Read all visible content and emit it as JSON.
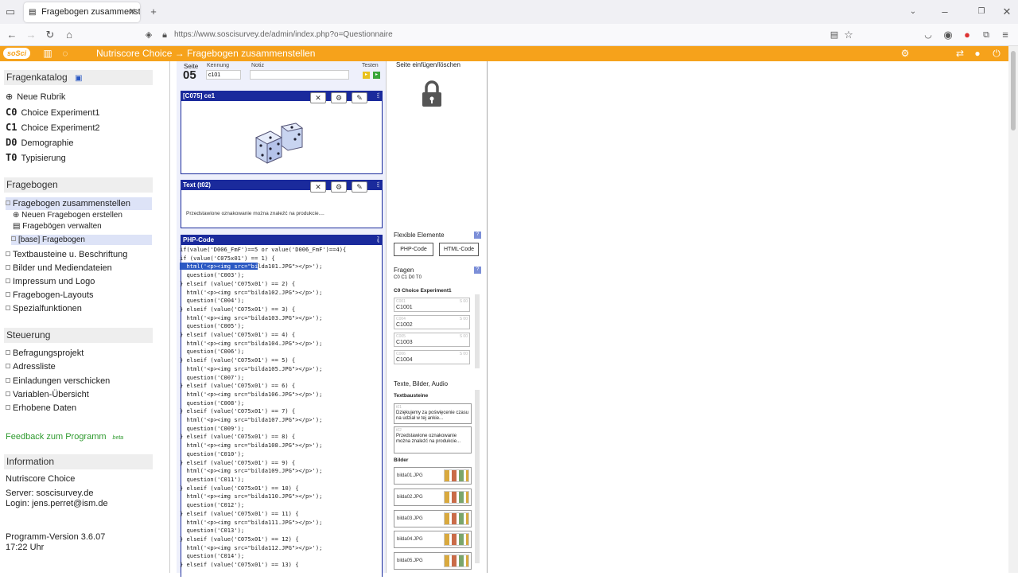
{
  "browser": {
    "tab_title": "Fragebogen zusammenstellen",
    "url": "https://www.soscisurvey.de/admin/index.php?o=Questionnaire"
  },
  "appbar": {
    "logo": "soSci",
    "title": "Nutriscore Choice → Fragebogen zusammenstellen",
    "color": "#f6a21b"
  },
  "sidebar": {
    "fragenkatalog": {
      "title": "Fragenkatalog",
      "items": [
        {
          "code": "",
          "label": "Neue Rubrik"
        },
        {
          "code": "C0",
          "label": "Choice Experiment1"
        },
        {
          "code": "C1",
          "label": "Choice Experiment2"
        },
        {
          "code": "D0",
          "label": "Demographie"
        },
        {
          "code": "T0",
          "label": "Typisierung"
        }
      ]
    },
    "fragebogen": {
      "title": "Fragebogen",
      "active": "Fragebogen zusammenstellen",
      "sub": [
        "Neuen Fragebogen erstellen",
        "Fragebögen verwalten"
      ],
      "base": "[base] Fragebogen",
      "items": [
        "Textbausteine u. Beschriftung",
        "Bilder und Mediendateien",
        "Impressum und Logo",
        "Fragebogen-Layouts",
        "Spezialfunktionen"
      ]
    },
    "steuerung": {
      "title": "Steuerung",
      "items": [
        "Befragungsprojekt",
        "Adressliste",
        "Einladungen verschicken",
        "Variablen-Übersicht",
        "Erhobene Daten"
      ]
    },
    "feedback": "Feedback zum Programm",
    "feedback_badge": "beta",
    "information": {
      "title": "Information",
      "project": "Nutriscore Choice",
      "server": "Server: soscisurvey.de",
      "login": "Login: jens.perret@ism.de",
      "version": "Programm-Version 3.6.07",
      "time": "17:22 Uhr"
    }
  },
  "page_header": {
    "seite_label": "Seite",
    "seite_value": "05",
    "kennung_label": "Kennung",
    "kennung_value": "c101",
    "notiz_label": "Notiz",
    "testen_label": "Testen"
  },
  "panels": {
    "p1": {
      "title": "[C075] ce1",
      "side": "TXT"
    },
    "p2": {
      "title": "Text (t02)",
      "text": "Przedstawione oznakowanie można znaleźć na produkcie....",
      "side": "TXT"
    },
    "p3": {
      "title": "PHP-Code",
      "side": "PHP"
    }
  },
  "php_code": {
    "l1": "if(value('D006_FmF')==5 or value('D006_FmF')==4){",
    "l2": "if (value('C075x01') == 1) {",
    "l3_hl": "  html('<p><img src=\"bi",
    "l3_rest": "lda101.JPG\"></p>');",
    "rest": "  question('C003');\n} elseif (value('C075x01') == 2) {\n  html('<p><img src=\"bilda102.JPG\"></p>');\n  question('C004');\n} elseif (value('C075x01') == 3) {\n  html('<p><img src=\"bilda103.JPG\"></p>');\n  question('C005');\n} elseif (value('C075x01') == 4) {\n  html('<p><img src=\"bilda104.JPG\"></p>');\n  question('C006');\n} elseif (value('C075x01') == 5) {\n  html('<p><img src=\"bilda105.JPG\"></p>');\n  question('C007');\n} elseif (value('C075x01') == 6) {\n  html('<p><img src=\"bilda106.JPG\"></p>');\n  question('C008');\n} elseif (value('C075x01') == 7) {\n  html('<p><img src=\"bilda107.JPG\"></p>');\n  question('C009');\n} elseif (value('C075x01') == 8) {\n  html('<p><img src=\"bilda108.JPG\"></p>');\n  question('C010');\n} elseif (value('C075x01') == 9) {\n  html('<p><img src=\"bilda109.JPG\"></p>');\n  question('C011');\n} elseif (value('C075x01') == 10) {\n  html('<p><img src=\"bilda110.JPG\"></p>');\n  question('C012');\n} elseif (value('C075x01') == 11) {\n  html('<p><img src=\"bilda111.JPG\"></p>');\n  question('C013');\n} elseif (value('C075x01') == 12) {\n  html('<p><img src=\"bilda112.JPG\"></p>');\n  question('C014');\n} elseif (value('C075x01') == 13) {"
  },
  "right": {
    "insert_delete": "Seite einfügen/löschen",
    "flexible": "Flexible Elemente",
    "btn_php": "PHP-Code",
    "btn_html": "HTML-Code",
    "fragen": "Fragen",
    "fragen_codes": "C0 C1 D0 T0",
    "ce_title": "C0 Choice Experiment1",
    "questions": [
      {
        "id": "C001",
        "name": "C1001",
        "tag": "S 00"
      },
      {
        "id": "C004",
        "name": "C1002",
        "tag": "S 00"
      },
      {
        "id": "C005",
        "name": "C1003",
        "tag": "S 00"
      },
      {
        "id": "C006",
        "name": "C1004",
        "tag": "S 00"
      }
    ],
    "texte": "Texte, Bilder, Audio",
    "textbausteine": "Textbausteine",
    "text_items": [
      {
        "id": "t01",
        "text": "Dziękujemy za poświęcenie czasu na udział w tej ankie..."
      },
      {
        "id": "t02",
        "text": "Przedstawione oznakowanie można znaleźć na produkcie..."
      }
    ],
    "bilder": "Bilder",
    "images": [
      "bilda01.JPG",
      "bilda02.JPG",
      "bilda03.JPG",
      "bilda04.JPG",
      "bilda05.JPG"
    ]
  }
}
